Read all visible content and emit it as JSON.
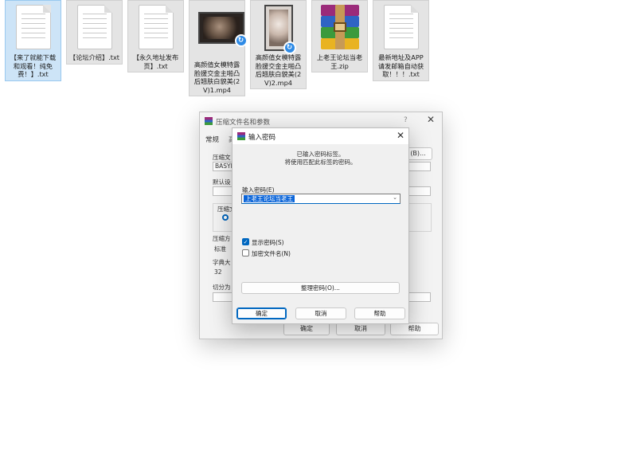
{
  "desktop": {
    "files": [
      {
        "name": "【来了就能下载和观看！纯免费！】.txt",
        "type": "txt",
        "selected": true
      },
      {
        "name": "【论坛介绍】.txt",
        "type": "txt"
      },
      {
        "name": "【永久地址发布页】.txt",
        "type": "txt"
      },
      {
        "name": "高颜值女模特露脸援交金主啪凸后翘肤白貌美(2V)1.mp4",
        "type": "mp4"
      },
      {
        "name": "高颜值女模特露脸援交金主啪凸后翘肤白貌美(2V)2.mp4",
        "type": "mp4"
      },
      {
        "name": "上老王论坛当老王.zip",
        "type": "zip"
      },
      {
        "name": "最新地址及APP请发邮箱自动获取！！！.txt",
        "type": "txt"
      }
    ]
  },
  "archive_dialog": {
    "title": "压缩文件名和参数",
    "help": "?",
    "close": "✕",
    "tab_general": "常规",
    "tab_second": "高",
    "archive_name_label": "压缩文",
    "archive_name_value": "BASYR",
    "browse_button": "(B)...",
    "profile_label": "默认设",
    "format_label": "压缩文",
    "method_label": "压缩方",
    "method_value": "标准",
    "dict_label": "字典大",
    "dict_value": "32",
    "split_label": "切分为",
    "ok_button": "确定",
    "cancel_button": "取消",
    "help_button": "帮助"
  },
  "password_dialog": {
    "title": "输入密码",
    "close": "✕",
    "info_line1": "已输入密码标签。",
    "info_line2": "将使用匹配此标签的密码。",
    "password_label": "输入密码(E)",
    "password_value": "上老王论坛当老王",
    "show_password": {
      "label": "显示密码(S)",
      "checked": true
    },
    "encrypt_names": {
      "label": "加密文件名(N)",
      "checked": false
    },
    "organize_button": "整理密码(O)...",
    "ok_button": "确定",
    "cancel_button": "取消",
    "help_button": "帮助"
  },
  "colors": {
    "accent": "#0067c0",
    "selection": "#0a64d8",
    "file_selected_bg": "#cde4f7"
  }
}
